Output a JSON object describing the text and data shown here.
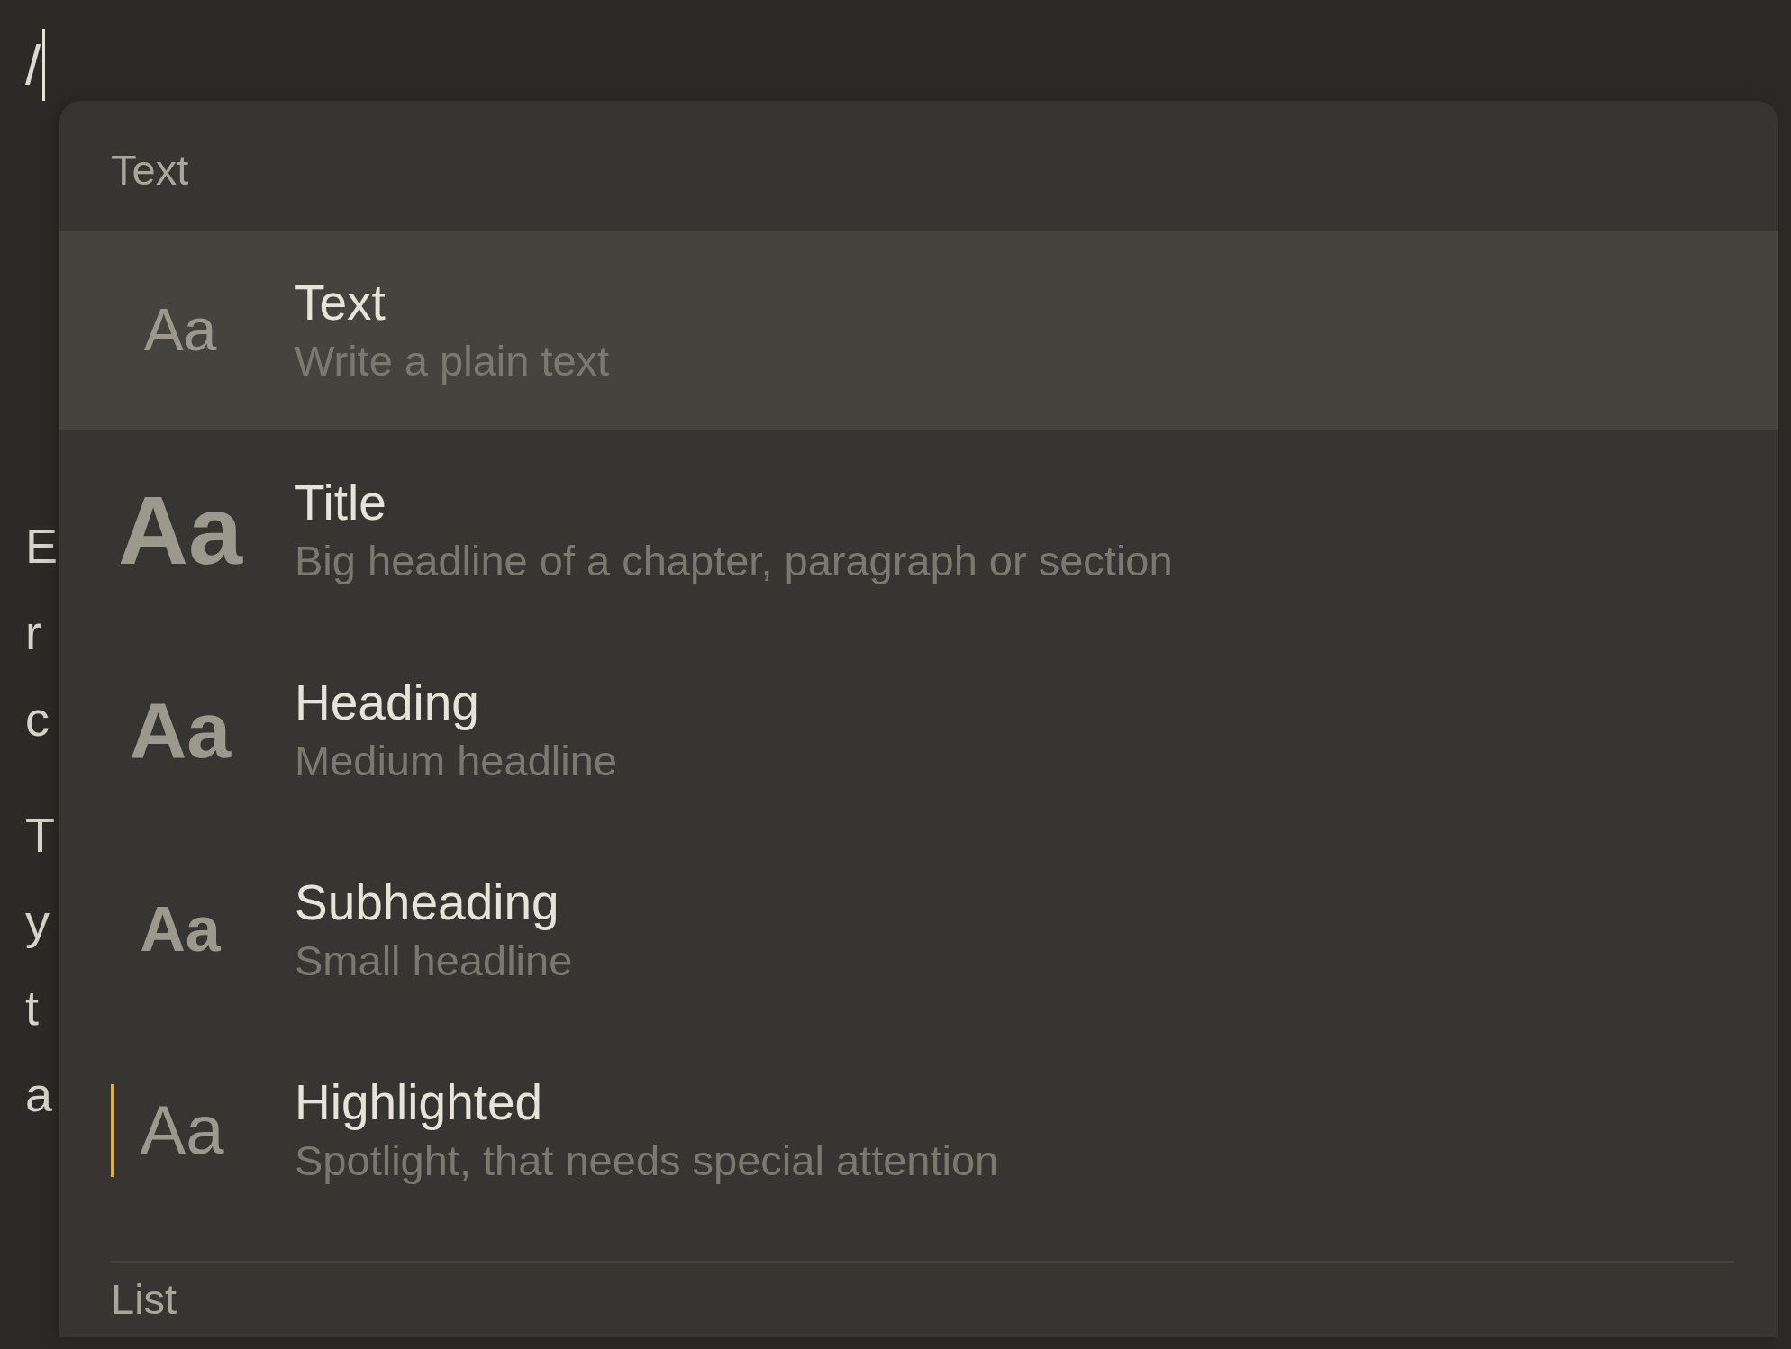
{
  "editor": {
    "value": "/",
    "focused": true,
    "paragraphs": [
      {
        "lines": [
          "E",
          "r",
          "c"
        ]
      },
      {
        "lines": [
          "T",
          "y",
          "t",
          "a"
        ]
      }
    ]
  },
  "menu": {
    "sections": [
      {
        "label": "Text",
        "items": [
          {
            "kind": "text",
            "preview": "Aa",
            "title": "Text",
            "description": "Write a plain text",
            "selected": true
          },
          {
            "kind": "title",
            "preview": "Aa",
            "title": "Title",
            "description": "Big headline of a chapter, paragraph or section",
            "selected": false
          },
          {
            "kind": "heading",
            "preview": "Aa",
            "title": "Heading",
            "description": "Medium headline",
            "selected": false
          },
          {
            "kind": "subheading",
            "preview": "Aa",
            "title": "Subheading",
            "description": "Small headline",
            "selected": false
          },
          {
            "kind": "highlighted",
            "preview": "Aa",
            "title": "Highlighted",
            "description": "Spotlight, that needs special attention",
            "selected": false
          }
        ]
      },
      {
        "label": "List"
      }
    ]
  }
}
